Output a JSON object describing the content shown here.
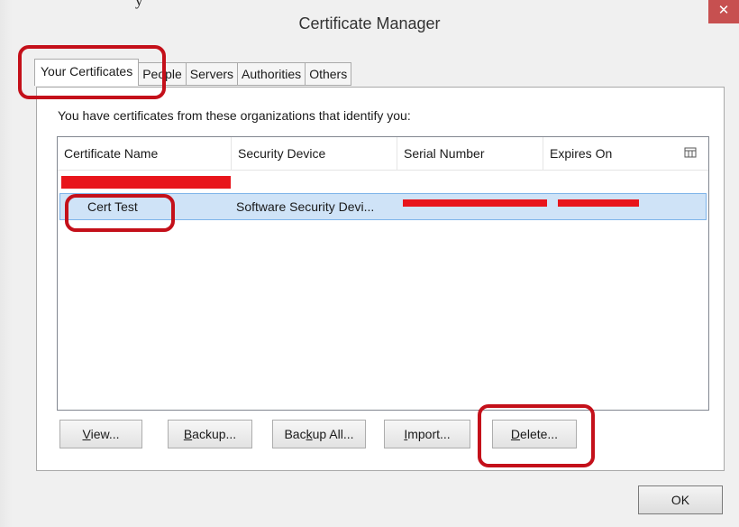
{
  "window": {
    "title": "Certificate Manager",
    "close_glyph": "✕",
    "cut_text": "y"
  },
  "tabs": [
    {
      "label": "Your Certificates",
      "active": true
    },
    {
      "label": "People",
      "active": false
    },
    {
      "label": "Servers",
      "active": false
    },
    {
      "label": "Authorities",
      "active": false
    },
    {
      "label": "Others",
      "active": false
    }
  ],
  "panel": {
    "intro": "You have certificates from these organizations that identify you:"
  },
  "table": {
    "columns": [
      "Certificate Name",
      "Security Device",
      "Serial Number",
      "Expires On"
    ],
    "column_picker_icon": "column-picker-icon",
    "rows": [
      {
        "name": "Cert Test",
        "device": "Software Security Devi...",
        "serial": "",
        "expires": "",
        "selected": true
      }
    ]
  },
  "buttons": {
    "view": {
      "pre": "",
      "key": "V",
      "post": "iew..."
    },
    "backup": {
      "pre": "",
      "key": "B",
      "post": "ackup..."
    },
    "backup_all": {
      "pre": "Bac",
      "key": "k",
      "post": "up All..."
    },
    "import": {
      "pre": "",
      "key": "I",
      "post": "mport..."
    },
    "delete": {
      "pre": "",
      "key": "D",
      "post": "elete..."
    },
    "ok": "OK"
  },
  "colors": {
    "highlight": "#c4101a",
    "redaction": "#e8151b",
    "selection": "#cfe3f7"
  }
}
